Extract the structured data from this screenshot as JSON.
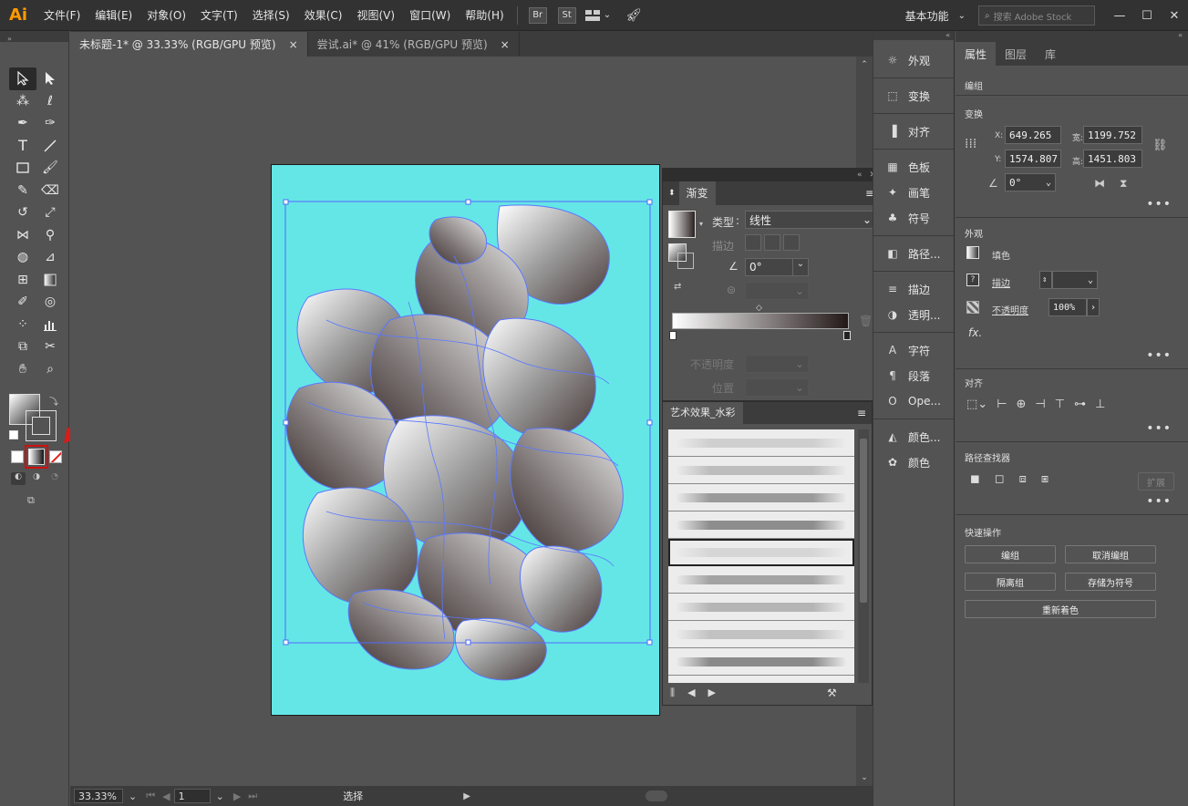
{
  "app": {
    "logo": "Ai"
  },
  "menu": [
    "文件(F)",
    "编辑(E)",
    "对象(O)",
    "文字(T)",
    "选择(S)",
    "效果(C)",
    "视图(V)",
    "窗口(W)",
    "帮助(H)"
  ],
  "menu_icons": {
    "bridge": "Br",
    "stock": "St"
  },
  "workspace": "基本功能",
  "stock_search_placeholder": "搜索 Adobe Stock",
  "tabs": [
    {
      "label": "未标题-1* @ 33.33% (RGB/GPU 预览)",
      "close": "×"
    },
    {
      "label": "尝试.ai* @ 41% (RGB/GPU 预览)",
      "close": "×"
    }
  ],
  "status": {
    "zoom": "33.33%",
    "page": "1",
    "tool": "选择"
  },
  "gradient_panel": {
    "title": "渐变",
    "type_label": "类型",
    "type_value": "线性",
    "stroke_label": "描边",
    "angle_value": "0°",
    "opacity_label": "不透明度",
    "position_label": "位置"
  },
  "brush_panel": {
    "title": "艺术效果_水彩"
  },
  "dock": {
    "group1": [
      {
        "icon": "sun-icon",
        "label": "外观"
      }
    ],
    "group2": [
      {
        "icon": "transform-icon",
        "label": "变换"
      }
    ],
    "group3": [
      {
        "icon": "align-icon",
        "label": "对齐"
      }
    ],
    "group4": [
      {
        "icon": "swatches-icon",
        "label": "色板"
      },
      {
        "icon": "brush-icon",
        "label": "画笔"
      },
      {
        "icon": "club-icon",
        "label": "符号"
      }
    ],
    "group5": [
      {
        "icon": "pathfinder-icon",
        "label": "路径..."
      }
    ],
    "group6": [
      {
        "icon": "stroke-icon",
        "label": "描边"
      },
      {
        "icon": "transparency-icon",
        "label": "透明..."
      }
    ],
    "group7": [
      {
        "icon": "character-icon",
        "label": "字符"
      },
      {
        "icon": "paragraph-icon",
        "label": "段落"
      },
      {
        "icon": "opentype-icon",
        "label": "Ope..."
      }
    ],
    "group8": [
      {
        "icon": "color-guide-icon",
        "label": "颜色..."
      },
      {
        "icon": "color-icon",
        "label": "颜色"
      }
    ]
  },
  "properties": {
    "tabs": [
      "属性",
      "图层",
      "库"
    ],
    "selection": "编组",
    "transform_title": "变换",
    "x_label": "X:",
    "x": "649.265",
    "y_label": "Y:",
    "y": "1574.807",
    "w_label": "宽:",
    "w": "1199.752",
    "h_label": "高:",
    "h": "1451.803",
    "angle": "0°",
    "appearance_title": "外观",
    "fill_label": "填色",
    "stroke_label": "描边",
    "opacity_label": "不透明度",
    "opacity": "100%",
    "fx": "fx.",
    "align_title": "对齐",
    "pathfinder_title": "路径查找器",
    "expand": "扩展",
    "quick_title": "快速操作",
    "btn_group": "编组",
    "btn_ungroup": "取消编组",
    "btn_isolate": "隔离组",
    "btn_symbol": "存储为符号",
    "btn_recolor": "重新着色"
  },
  "colors": {
    "artboard": "#65e6e6",
    "selection": "#4f6bff",
    "arrow": "#e01818",
    "highlight_box": "#d01010"
  }
}
